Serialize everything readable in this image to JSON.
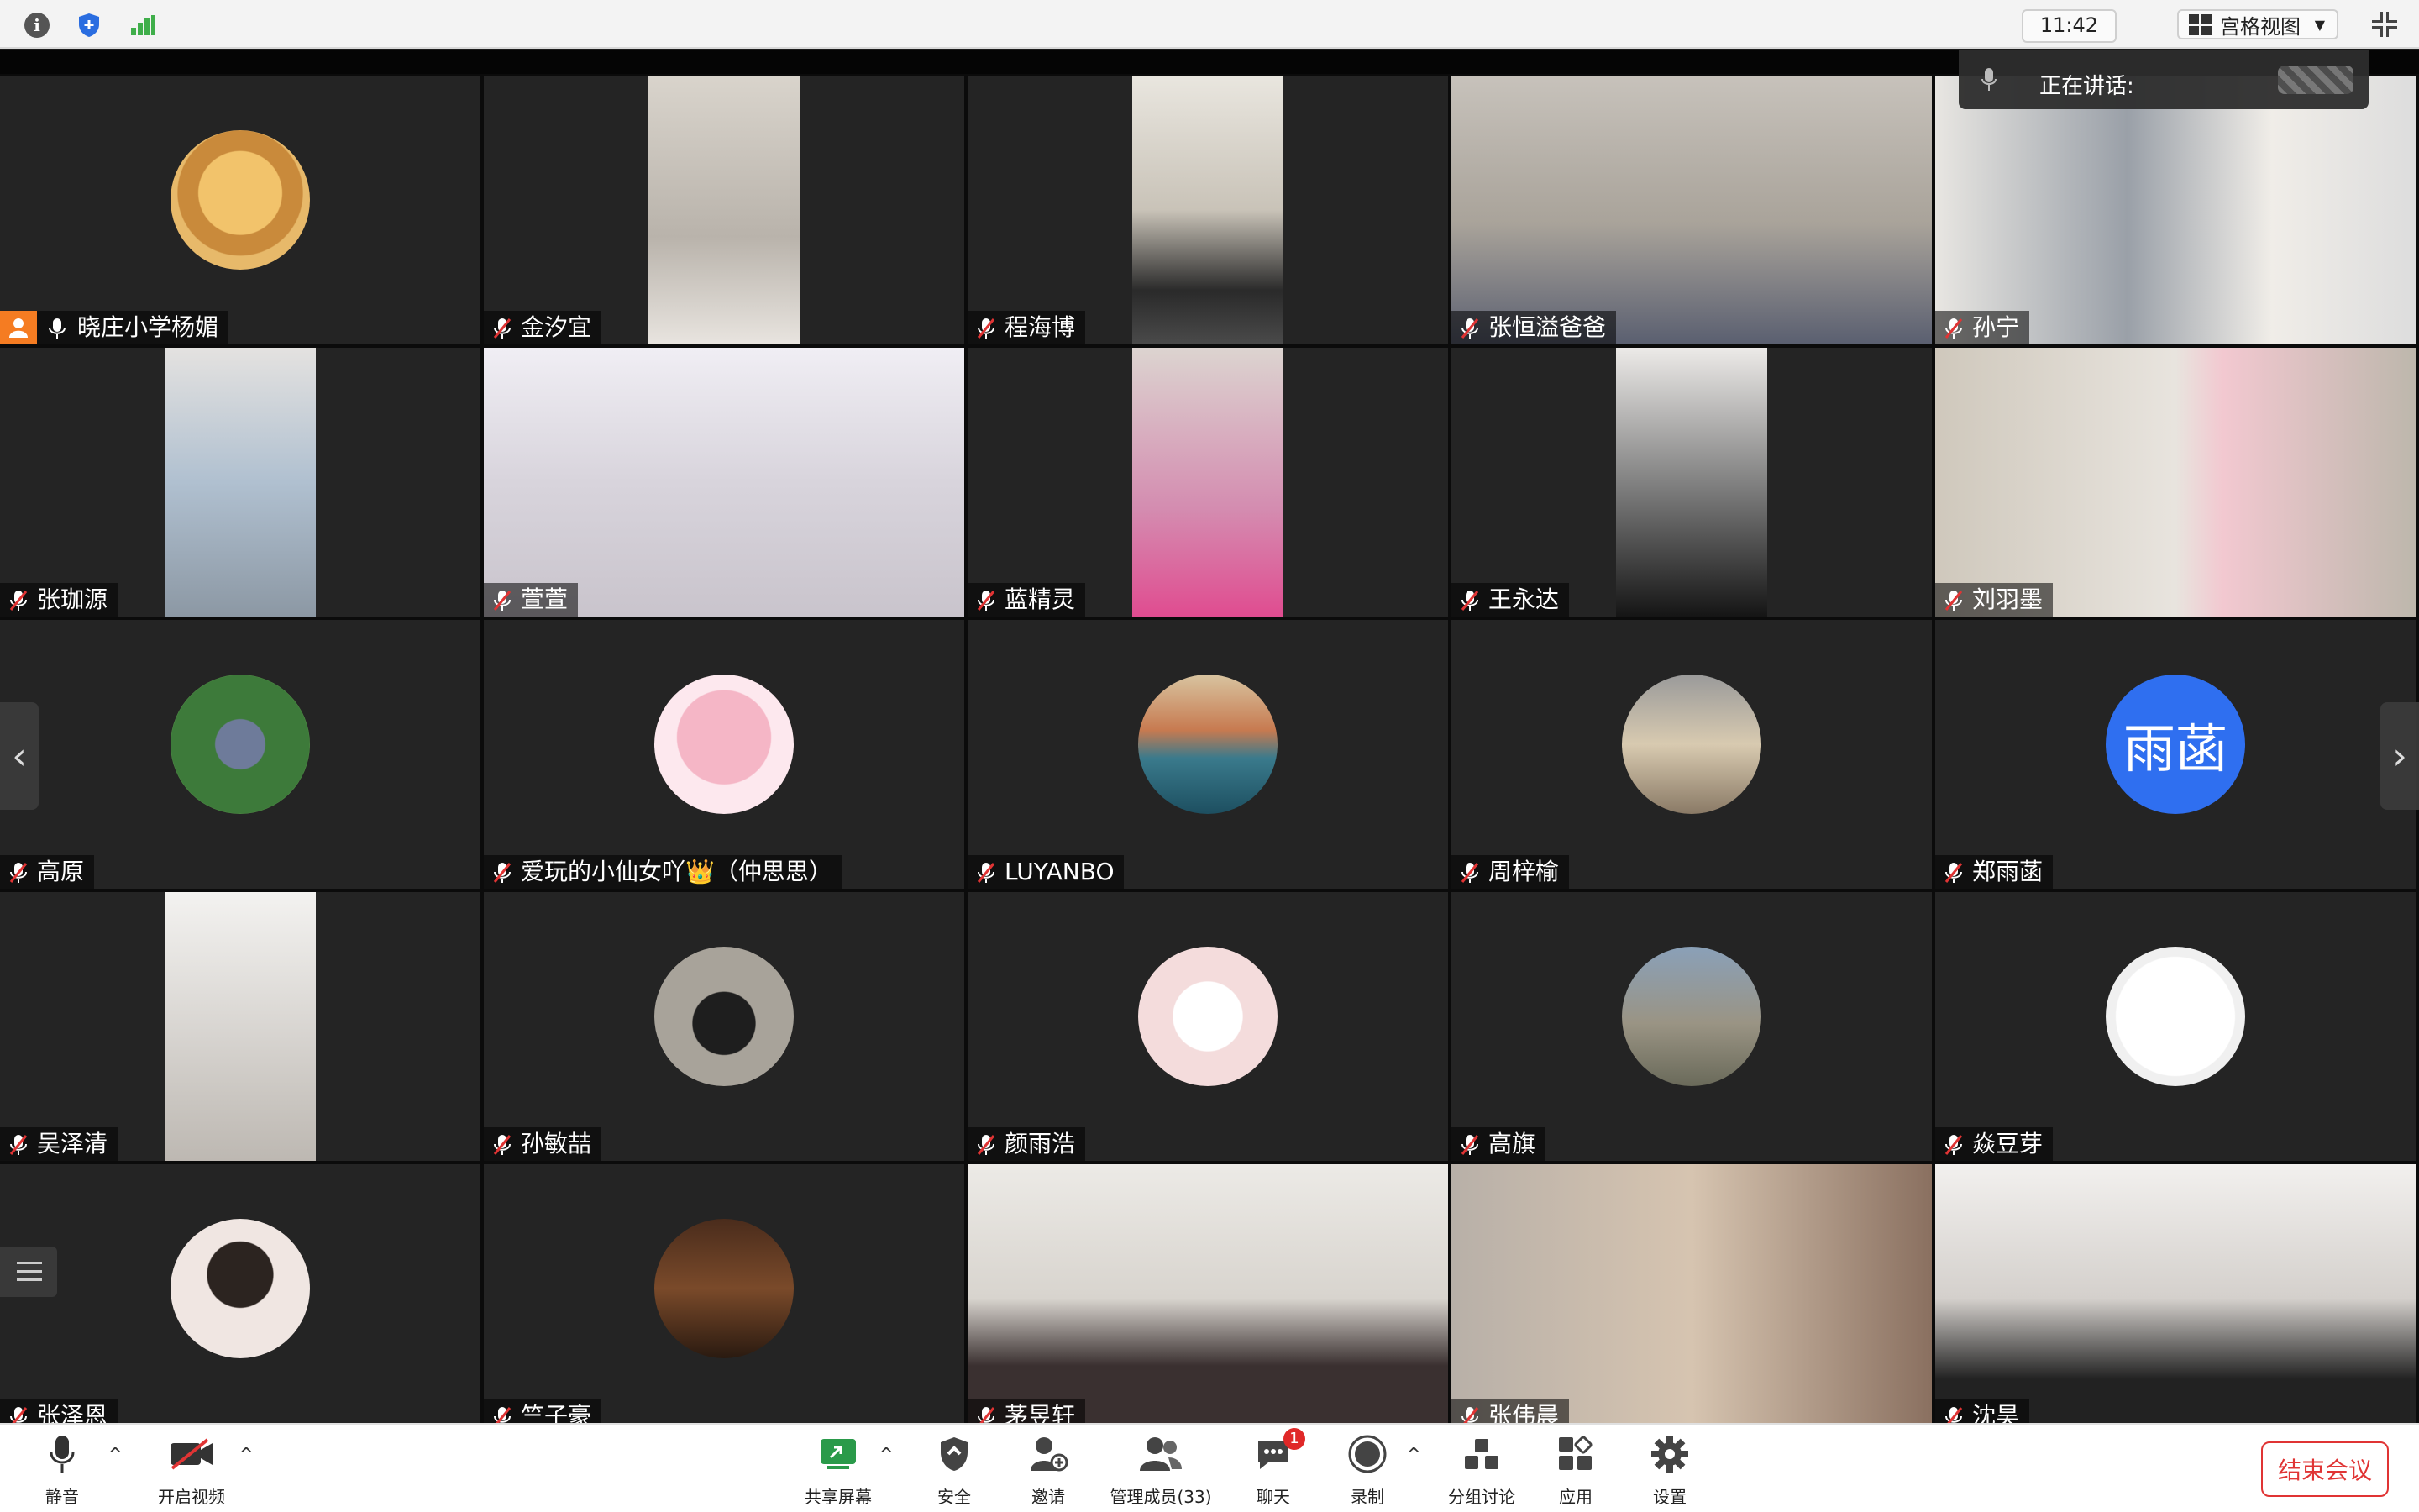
{
  "topbar": {
    "time": "11:42",
    "view_label": "宫格视图"
  },
  "speaking": {
    "label": "正在讲话:"
  },
  "colors": {
    "accent_orange": "#f57c22",
    "end_red": "#e03434",
    "avatar_blue": "#2f6ff0"
  },
  "participants": [
    {
      "name": "晓庄小学杨媚",
      "host": true
    },
    {
      "name": "金汐宜"
    },
    {
      "name": "程海博"
    },
    {
      "name": "张恒溢爸爸"
    },
    {
      "name": "孙宁"
    },
    {
      "name": "张珈源"
    },
    {
      "name": "萱萱"
    },
    {
      "name": "蓝精灵"
    },
    {
      "name": "王永达"
    },
    {
      "name": "刘羽墨"
    },
    {
      "name": "高原"
    },
    {
      "name": "爱玩的小仙女吖👑（仲思思）"
    },
    {
      "name": "LUYANBO"
    },
    {
      "name": "周梓榆"
    },
    {
      "name": "郑雨菡",
      "initials": "雨菡"
    },
    {
      "name": "吴泽清"
    },
    {
      "name": "孙敏喆"
    },
    {
      "name": "颜雨浩"
    },
    {
      "name": "高旗"
    },
    {
      "name": "焱豆芽"
    },
    {
      "name": "张泽恩"
    },
    {
      "name": "竺子豪"
    },
    {
      "name": "茅昱轩"
    },
    {
      "name": "张伟晨"
    },
    {
      "name": "沈昊"
    }
  ],
  "toolbar": {
    "mute": "静音",
    "video": "开启视频",
    "share": "共享屏幕",
    "security": "安全",
    "invite": "邀请",
    "members": "管理成员(33)",
    "chat": "聊天",
    "chat_badge": "1",
    "record": "录制",
    "breakout": "分组讨论",
    "apps": "应用",
    "settings": "设置",
    "end": "结束会议"
  }
}
